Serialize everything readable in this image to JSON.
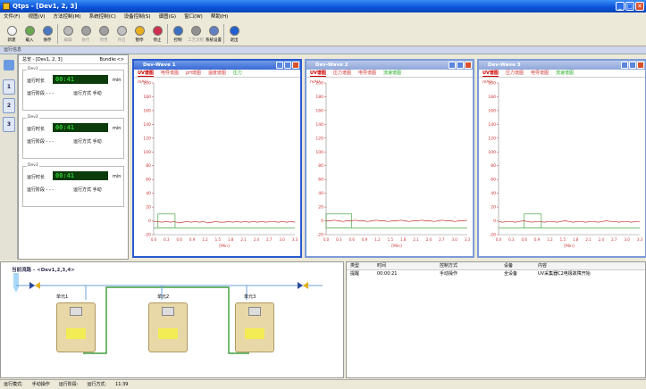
{
  "window": {
    "title": "Qtps - [Dev1, 2, 3]"
  },
  "menu": [
    "文件(F)",
    "视图(V)",
    "方法控制(M)",
    "系统控制(C)",
    "设备控制(S)",
    "谱图(G)",
    "窗口(W)",
    "帮助(H)"
  ],
  "toolbar": [
    {
      "label": "新建",
      "color": "#f4f4f4",
      "disabled": false
    },
    {
      "label": "载入",
      "color": "#6aa84f",
      "disabled": false
    },
    {
      "label": "保存",
      "color": "#4a78c0",
      "disabled": false
    },
    {
      "label": "编辑",
      "color": "#b8b8b8",
      "disabled": true
    },
    {
      "label": "执行",
      "color": "#a0a0a0",
      "disabled": true
    },
    {
      "label": "停用",
      "color": "#a0a0a0",
      "disabled": true
    },
    {
      "label": "开启",
      "color": "#c0c0c0",
      "disabled": true
    },
    {
      "label": "暂停",
      "color": "#e8b020",
      "disabled": false
    },
    {
      "label": "停止",
      "color": "#d03050",
      "disabled": false
    },
    {
      "label": "控制",
      "color": "#3a70c0",
      "disabled": false
    },
    {
      "label": "工艺流程",
      "color": "#909090",
      "disabled": true
    },
    {
      "label": "系统设置",
      "color": "#6080c0",
      "disabled": false
    },
    {
      "label": "退出",
      "color": "#2060d0",
      "disabled": false
    }
  ],
  "stripe": "运行信息",
  "left_tabs": [
    "1",
    "2",
    "3"
  ],
  "overview": {
    "title": "总览 - [Dev1, 2, 3]",
    "bundle": "Bundle:<>",
    "devices": [
      {
        "name": "Dev1",
        "runtime_label": "运行时长",
        "lcd": "00:41",
        "unit": "min",
        "stage_label": "运行阶段",
        "stage_value": "- - -",
        "mode_label": "运行方式",
        "mode_value": "手动"
      },
      {
        "name": "Dev2",
        "runtime_label": "运行时长",
        "lcd": "00:41",
        "unit": "min",
        "stage_label": "运行阶段",
        "stage_value": "- - -",
        "mode_label": "运行方式",
        "mode_value": "手动"
      },
      {
        "name": "Dev3",
        "runtime_label": "运行时长",
        "lcd": "00:41",
        "unit": "min",
        "stage_label": "运行阶段",
        "stage_value": "- - -",
        "mode_label": "运行方式",
        "mode_value": "手动"
      }
    ]
  },
  "waves": [
    {
      "title": "Dev-Wave 1",
      "tabs": [
        "UV谱图",
        "电导谱图",
        "pH谱图",
        "温度谱图",
        "压力"
      ],
      "active_tab": 0
    },
    {
      "title": "Dev-Wave 2",
      "tabs": [
        "UV谱图",
        "压力谱图",
        "电导谱图",
        "流速谱图"
      ],
      "active_tab": 0
    },
    {
      "title": "Dev-Wave 3",
      "tabs": [
        "UV谱图",
        "压力谱图",
        "电导谱图",
        "流速谱图"
      ],
      "active_tab": 0
    }
  ],
  "chart_data": [
    {
      "type": "line",
      "ylabel": "mAU",
      "xlabel": "[Min]",
      "ylim": [
        -20,
        200
      ],
      "xlim": [
        0,
        3.3
      ],
      "yticks": [
        "200",
        "180",
        "160",
        "140",
        "120",
        "100",
        "80",
        "60",
        "40",
        "20",
        "0",
        "-20"
      ],
      "xticks": [
        "0.0",
        "0.3",
        "0.6",
        "0.9",
        "1.2",
        "1.5",
        "1.8",
        "2.1",
        "2.4",
        "2.7",
        "3.0",
        "3.3"
      ],
      "series": [
        {
          "values": [
            -1,
            -1,
            -2,
            -1,
            -2,
            -1,
            -3,
            -2,
            -1,
            -2,
            -1,
            -2,
            -1,
            -3,
            -2,
            -1,
            -2,
            -2,
            -1,
            -2,
            -1,
            -2,
            -1,
            -2,
            -1,
            -2,
            -1,
            -2,
            -1,
            -1,
            -2,
            -1,
            -2,
            -1,
            -2
          ],
          "color": "#c03030"
        }
      ],
      "marker_window": [
        0.1,
        0.5
      ],
      "reference_line": -10
    },
    {
      "type": "line",
      "ylabel": "mAU",
      "xlabel": "[Min]",
      "ylim": [
        -20,
        200
      ],
      "xlim": [
        0,
        3.3
      ],
      "yticks": [
        "200",
        "180",
        "160",
        "140",
        "120",
        "100",
        "80",
        "60",
        "40",
        "20",
        "0",
        "-20"
      ],
      "xticks": [
        "0.0",
        "0.3",
        "0.6",
        "0.9",
        "1.2",
        "1.5",
        "1.8",
        "2.1",
        "2.4",
        "2.7",
        "3.0",
        "3.3"
      ],
      "series": [
        {
          "values": [
            0,
            0,
            1,
            0,
            -1,
            0,
            0,
            1,
            0,
            0,
            -1,
            0,
            1,
            0,
            0,
            -1,
            0,
            0,
            1,
            0,
            -1,
            0,
            0,
            1,
            0,
            0,
            -1,
            0,
            1,
            0,
            0,
            -1,
            0,
            0,
            1
          ],
          "color": "#c03030"
        }
      ],
      "marker_window": [
        0.0,
        0.6
      ],
      "reference_line": -10
    },
    {
      "type": "line",
      "ylabel": "mAU",
      "xlabel": "[Min]",
      "ylim": [
        -20,
        200
      ],
      "xlim": [
        0,
        3.3
      ],
      "yticks": [
        "200",
        "180",
        "160",
        "140",
        "120",
        "100",
        "80",
        "60",
        "40",
        "20",
        "0",
        "-20"
      ],
      "xticks": [
        "0.0",
        "0.3",
        "0.6",
        "0.9",
        "1.2",
        "1.5",
        "1.8",
        "2.1",
        "2.4",
        "2.7",
        "3.0",
        "3.3"
      ],
      "series": [
        {
          "values": [
            -1,
            -2,
            -1,
            -1,
            -2,
            -1,
            0,
            -1,
            -2,
            -1,
            -1,
            -2,
            -1,
            -1,
            -2,
            -1,
            0,
            -1,
            -2,
            -1,
            -1,
            -2,
            -1,
            -1,
            -2,
            -1,
            0,
            -1,
            -1,
            -2,
            -1,
            -1,
            -2,
            -1,
            -1
          ],
          "color": "#c03030"
        }
      ],
      "marker_window": [
        0.6,
        1.0
      ],
      "reference_line": -10
    }
  ],
  "flow": {
    "title": "当前流路 - <Dev1,2,3,4>",
    "units": [
      "单元1",
      "单元2",
      "单元3"
    ]
  },
  "log": {
    "headers": [
      "类型",
      "时间",
      "控制方式",
      "设备",
      "内容"
    ],
    "rows": [
      [
        "提醒",
        "00:00:21",
        "手动操作",
        "全设备",
        "UV采集器C2电极故障开始"
      ]
    ]
  },
  "status": [
    "运行模式:",
    "手动操作",
    "运行阶段:",
    "运行方式:",
    "11:39"
  ]
}
